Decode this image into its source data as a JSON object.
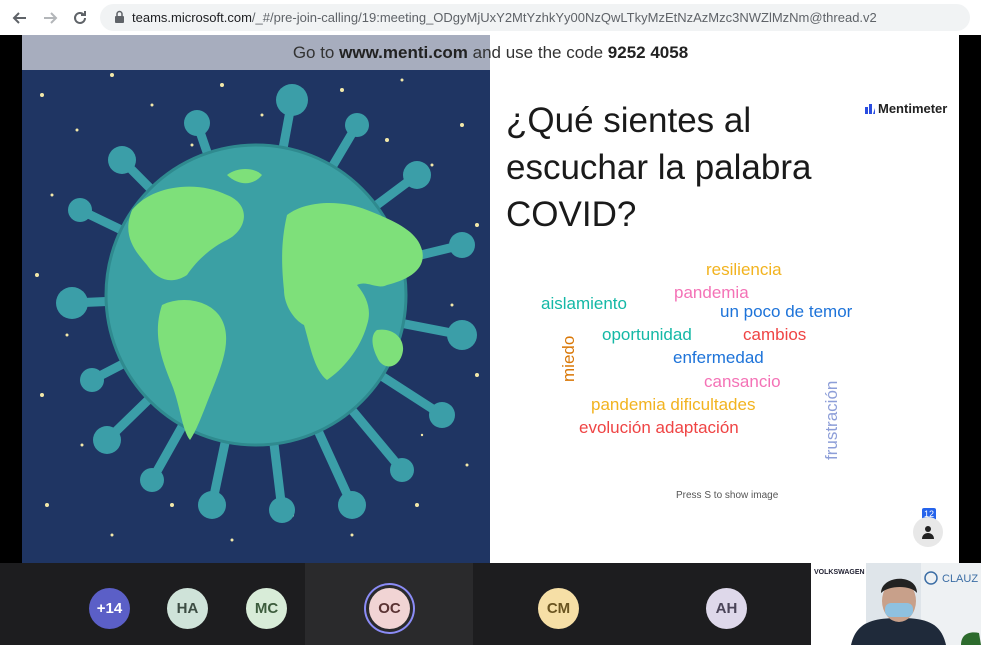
{
  "browser": {
    "url_prefix": "teams.microsoft.com",
    "url_rest": "/_#/pre-join-calling/19:meeting_ODgyMjUxY2MtYzhkYy00NzQwLTkyMzEtNzAzMzc3NWZlMzNm@thread.v2"
  },
  "slide": {
    "banner_pre": "Go to ",
    "banner_site": "www.menti.com",
    "banner_mid": " and use the code ",
    "banner_code": "9252 4058",
    "question": "¿Qué sientes al escuchar la palabra COVID?",
    "brand": "Mentimeter",
    "hint": "Press S to show image",
    "response_count": "12"
  },
  "wordcloud": [
    {
      "text": "resiliencia",
      "color": "#f2b31f"
    },
    {
      "text": "pandemia",
      "color": "#f472b6"
    },
    {
      "text": "aislamiento",
      "color": "#14b8a6"
    },
    {
      "text": "un poco de temor",
      "color": "#1d73d9"
    },
    {
      "text": "oportunidad",
      "color": "#14b8a6"
    },
    {
      "text": "cambios",
      "color": "#ef4444"
    },
    {
      "text": "miedo",
      "color": "#d97706"
    },
    {
      "text": "enfermedad",
      "color": "#1d73d9"
    },
    {
      "text": "cansancio",
      "color": "#f472b6"
    },
    {
      "text": "frustración",
      "color": "#8d9ed8"
    },
    {
      "text": "pandemia dificultades",
      "color": "#f2b31f"
    },
    {
      "text": "evolución adaptación",
      "color": "#ef4444"
    }
  ],
  "participants": [
    {
      "initials": "+14",
      "bg": "#5b5fc7",
      "fg": "#ffffff"
    },
    {
      "initials": "HA",
      "bg": "#cfe3d9",
      "fg": "#3c4c43"
    },
    {
      "initials": "MC",
      "bg": "#d8ecd8",
      "fg": "#3c5c3c"
    },
    {
      "initials": "OC",
      "bg": "#f1d4d4",
      "fg": "#5a3333"
    },
    {
      "initials": "CM",
      "bg": "#f6dfa6",
      "fg": "#6a5420"
    },
    {
      "initials": "AH",
      "bg": "#ded8ea",
      "fg": "#4a4458"
    }
  ],
  "video": {
    "logo_left": "VOLKSWAGEN",
    "logo_right": "CLAUZ"
  }
}
